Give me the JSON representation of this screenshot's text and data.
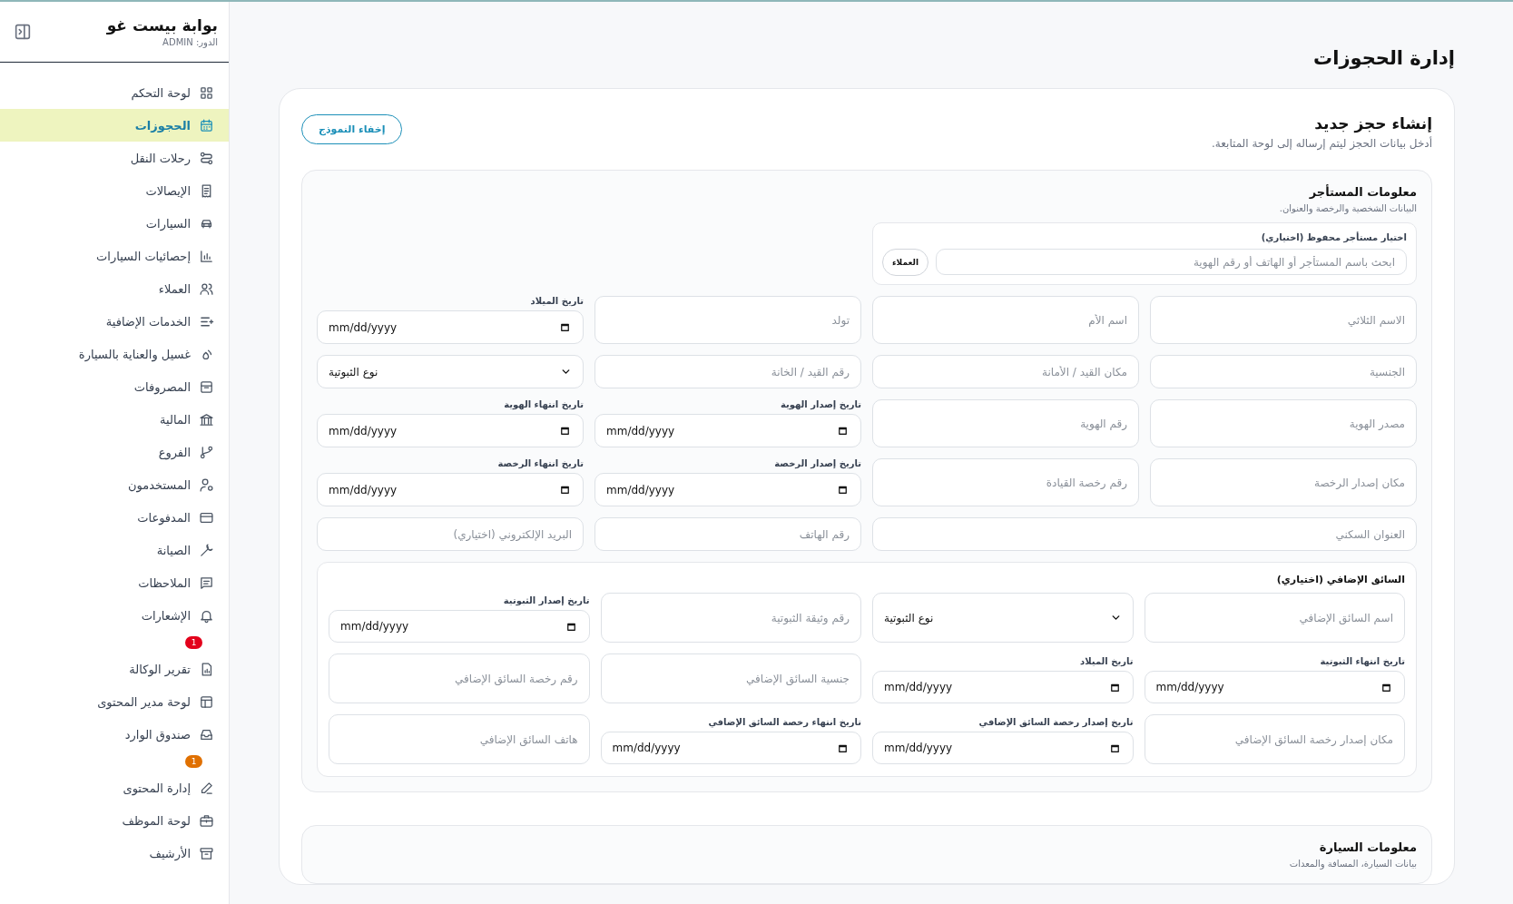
{
  "sidebar": {
    "title": "بوابة بيست غو",
    "role": "الدور: ADMIN",
    "items": [
      {
        "label": "لوحة التحكم",
        "selected": false
      },
      {
        "label": "الحجوزات",
        "selected": true
      },
      {
        "label": "رحلات النقل",
        "selected": false
      },
      {
        "label": "الإيصالات",
        "selected": false
      },
      {
        "label": "السيارات",
        "selected": false
      },
      {
        "label": "إحصائيات السيارات",
        "selected": false
      },
      {
        "label": "العملاء",
        "selected": false
      },
      {
        "label": "الخدمات الإضافية",
        "selected": false
      },
      {
        "label": "غسيل والعناية بالسيارة",
        "selected": false
      },
      {
        "label": "المصروفات",
        "selected": false
      },
      {
        "label": "المالية",
        "selected": false
      },
      {
        "label": "الفروع",
        "selected": false
      },
      {
        "label": "المستخدمون",
        "selected": false
      },
      {
        "label": "المدفوعات",
        "selected": false
      },
      {
        "label": "الصيانة",
        "selected": false
      },
      {
        "label": "الملاحظات",
        "selected": false
      },
      {
        "label": "الإشعارات",
        "selected": false,
        "badge": "1",
        "color": "#e3001b"
      },
      {
        "label": "تقرير الوكالة",
        "selected": false
      },
      {
        "label": "لوحة مدير المحتوى",
        "selected": false
      },
      {
        "label": "صندوق الوارد",
        "selected": false,
        "badge": "1",
        "color": "#e07000"
      },
      {
        "label": "إدارة المحتوى",
        "selected": false
      },
      {
        "label": "لوحة الموظف",
        "selected": false
      },
      {
        "label": "الأرشيف",
        "selected": false
      }
    ]
  },
  "page_title": "إدارة الحجوزات",
  "form": {
    "title": "إنشاء حجز جديد",
    "subtitle": "أدخل بيانات الحجز ليتم إرساله إلى لوحة المتابعة.",
    "hide_button": "إخفاء النموذج",
    "renter": {
      "title": "معلومات المستأجر",
      "subtitle": "البيانات الشخصية والرخصة والعنوان.",
      "saved_renter": {
        "label": "اختيار مستأجر محفوظ (اختياري)",
        "placeholder": "ابحث باسم المستأجر أو الهاتف أو رقم الهوية",
        "button": "العملاء"
      },
      "fields": [
        {
          "kind": "text",
          "placeholder": "الاسم الثلاثي"
        },
        {
          "kind": "text",
          "placeholder": "اسم الأم"
        },
        {
          "kind": "text",
          "placeholder": "تولد"
        },
        {
          "kind": "date",
          "label": "تاريخ الميلاد",
          "value": "mm/dd/yyyy"
        },
        {
          "kind": "text",
          "placeholder": "الجنسية"
        },
        {
          "kind": "text",
          "placeholder": "مكان القيد / الأمانة"
        },
        {
          "kind": "text",
          "placeholder": "رقم القيد / الخانة"
        },
        {
          "kind": "select",
          "value": "نوع الثبوتية"
        },
        {
          "kind": "text",
          "placeholder": "مصدر الهوية"
        },
        {
          "kind": "text",
          "placeholder": "رقم الهوية"
        },
        {
          "kind": "date",
          "label": "تاريخ إصدار الهوية",
          "value": "mm/dd/yyyy"
        },
        {
          "kind": "date",
          "label": "تاريخ انتهاء الهوية",
          "value": "mm/dd/yyyy"
        },
        {
          "kind": "text",
          "placeholder": "مكان إصدار الرخصة"
        },
        {
          "kind": "text",
          "placeholder": "رقم رخصة القيادة"
        },
        {
          "kind": "date",
          "label": "تاريخ إصدار الرخصة",
          "value": "mm/dd/yyyy"
        },
        {
          "kind": "date",
          "label": "تاريخ انتهاء الرخصة",
          "value": "mm/dd/yyyy"
        },
        {
          "kind": "wide",
          "placeholder": "العنوان السكني"
        },
        {
          "kind": "text",
          "placeholder": "رقم الهاتف"
        },
        {
          "kind": "text",
          "placeholder": "البريد الإلكتروني (اختياري)"
        }
      ],
      "additional_driver": {
        "title": "السائق الإضافي (اختياري)",
        "fields": [
          {
            "kind": "text",
            "placeholder": "اسم السائق الإضافي"
          },
          {
            "kind": "select",
            "value": "نوع الثبوتية"
          },
          {
            "kind": "text",
            "placeholder": "رقم وثيقة الثبوتية"
          },
          {
            "kind": "date",
            "label": "تاريخ إصدار الثبوتية",
            "value": "mm/dd/yyyy"
          },
          {
            "kind": "date",
            "label": "تاريخ انتهاء الثبوتية",
            "value": "mm/dd/yyyy"
          },
          {
            "kind": "date",
            "label": "تاريخ الميلاد",
            "value": "mm/dd/yyyy"
          },
          {
            "kind": "text",
            "placeholder": "جنسية السائق الإضافي"
          },
          {
            "kind": "text",
            "placeholder": "رقم رخصة السائق الإضافي"
          },
          {
            "kind": "text",
            "placeholder": "مكان إصدار رخصة السائق الإضافي"
          },
          {
            "kind": "date",
            "label": "تاريخ إصدار رخصة السائق الإضافي",
            "value": "mm/dd/yyyy"
          },
          {
            "kind": "date",
            "label": "تاريخ انتهاء رخصة السائق الإضافي",
            "value": "mm/dd/yyyy"
          },
          {
            "kind": "text",
            "placeholder": "هاتف السائق الإضافي"
          }
        ]
      }
    },
    "vehicle": {
      "title": "معلومات السيارة",
      "subtitle": "بيانات السيارة، المسافة والمعدات"
    }
  }
}
